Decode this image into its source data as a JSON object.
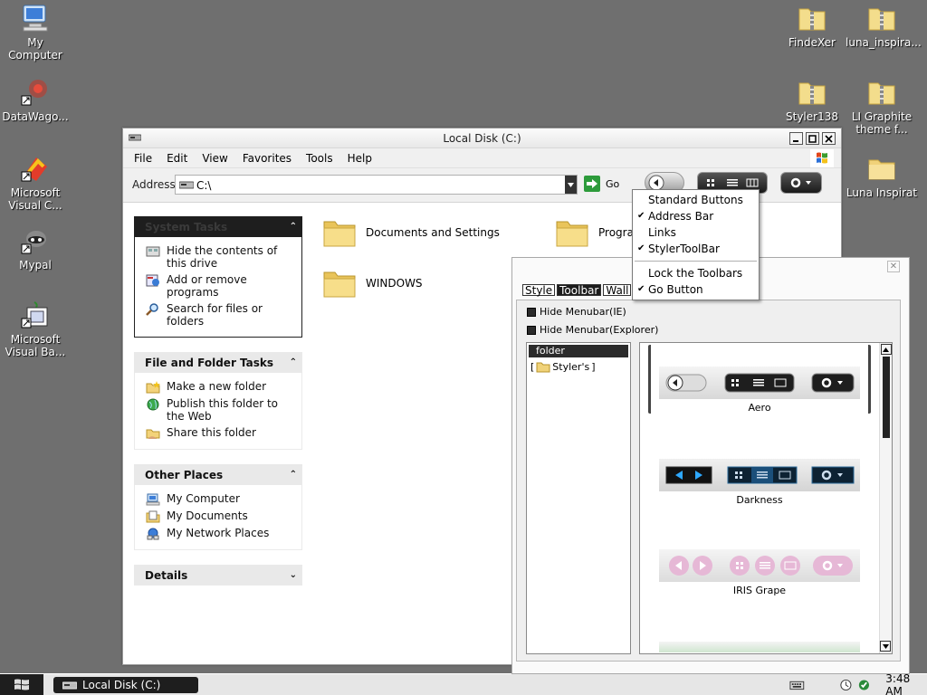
{
  "desktop_icons": [
    {
      "label": "My Computer",
      "icon": "my-computer-icon"
    },
    {
      "label": "DataWago...",
      "icon": "datawago-shortcut-icon"
    },
    {
      "label": "Microsoft\nVisual C...",
      "icon": "visual-c-shortcut-icon"
    },
    {
      "label": "Mypal",
      "icon": "mypal-shortcut-icon"
    },
    {
      "label": "Microsoft\nVisual Ba...",
      "icon": "visual-basic-shortcut-icon"
    },
    {
      "label": "FindeXer",
      "icon": "zip-folder-icon"
    },
    {
      "label": "luna_inspira...",
      "icon": "zip-folder-icon"
    },
    {
      "label": "Styler138",
      "icon": "zip-folder-icon"
    },
    {
      "label": "LI Graphite\ntheme f...",
      "icon": "zip-folder-icon"
    },
    {
      "label": "Luna Inspirat",
      "icon": "folder-icon"
    }
  ],
  "explorer": {
    "title": "Local Disk (C:)",
    "menu": [
      "File",
      "Edit",
      "View",
      "Favorites",
      "Tools",
      "Help"
    ],
    "address_label": "Address",
    "address_value": "C:\\",
    "go_label": "Go",
    "panels": {
      "system_tasks": {
        "title": "System Tasks",
        "items": [
          "Hide the contents of this drive",
          "Add or remove programs",
          "Search for files or folders"
        ]
      },
      "file_folder_tasks": {
        "title": "File and Folder Tasks",
        "items": [
          "Make a new folder",
          "Publish this folder to the Web",
          "Share this folder"
        ]
      },
      "other_places": {
        "title": "Other Places",
        "items": [
          "My Computer",
          "My Documents",
          "My Network Places"
        ]
      },
      "details": {
        "title": "Details"
      }
    },
    "folders": [
      "Documents and Settings",
      "Program",
      "WINDOWS"
    ]
  },
  "context_menu": {
    "items": [
      {
        "label": "Standard Buttons",
        "checked": false
      },
      {
        "label": "Address Bar",
        "checked": true
      },
      {
        "label": "Links",
        "checked": false
      },
      {
        "label": "StylerToolBar",
        "checked": true
      },
      {
        "label": "Lock the Toolbars",
        "checked": false
      },
      {
        "label": "Go Button",
        "checked": true
      }
    ],
    "check_glyph": "✔"
  },
  "styler": {
    "close_glyph": "✕",
    "tabs": [
      "Style",
      "Toolbar",
      "Wall"
    ],
    "active_tab": "Toolbar",
    "checkboxes": [
      "Hide Menubar(IE)",
      "Hide Menubar(Explorer)"
    ],
    "tree_header": "folder",
    "tree_item": "Styler's",
    "themes": [
      "Aero",
      "Darkness",
      "IRIS Grape"
    ]
  },
  "taskbar": {
    "task_label": "Local Disk (C:)",
    "clock": "3:48 AM"
  }
}
